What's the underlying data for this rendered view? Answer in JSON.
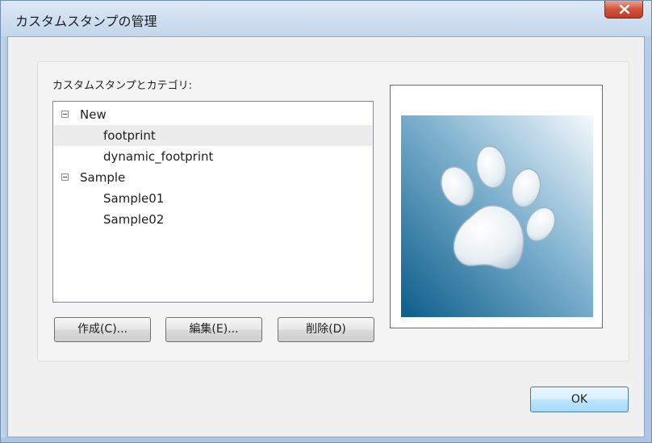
{
  "window": {
    "title": "カスタムスタンプの管理"
  },
  "group": {
    "tree_label": "カスタムスタンプとカテゴリ:",
    "tree": [
      {
        "label": "New",
        "expander": "minus"
      },
      {
        "label": "footprint",
        "selected": true
      },
      {
        "label": "dynamic_footprint"
      },
      {
        "label": "Sample",
        "expander": "minus"
      },
      {
        "label": "Sample01"
      },
      {
        "label": "Sample02"
      }
    ],
    "buttons": {
      "create": "作成(C)...",
      "edit": "編集(E)...",
      "delete": "削除(D)"
    },
    "preview": {
      "icon": "paw-print-icon"
    }
  },
  "footer": {
    "ok": "OK"
  },
  "colors": {
    "titlebar": "#c9d9ec",
    "close_button": "#c94a33",
    "selection": "#ececec",
    "stamp_dark": "#0b5d8a",
    "stamp_light": "#e9f3f8"
  }
}
